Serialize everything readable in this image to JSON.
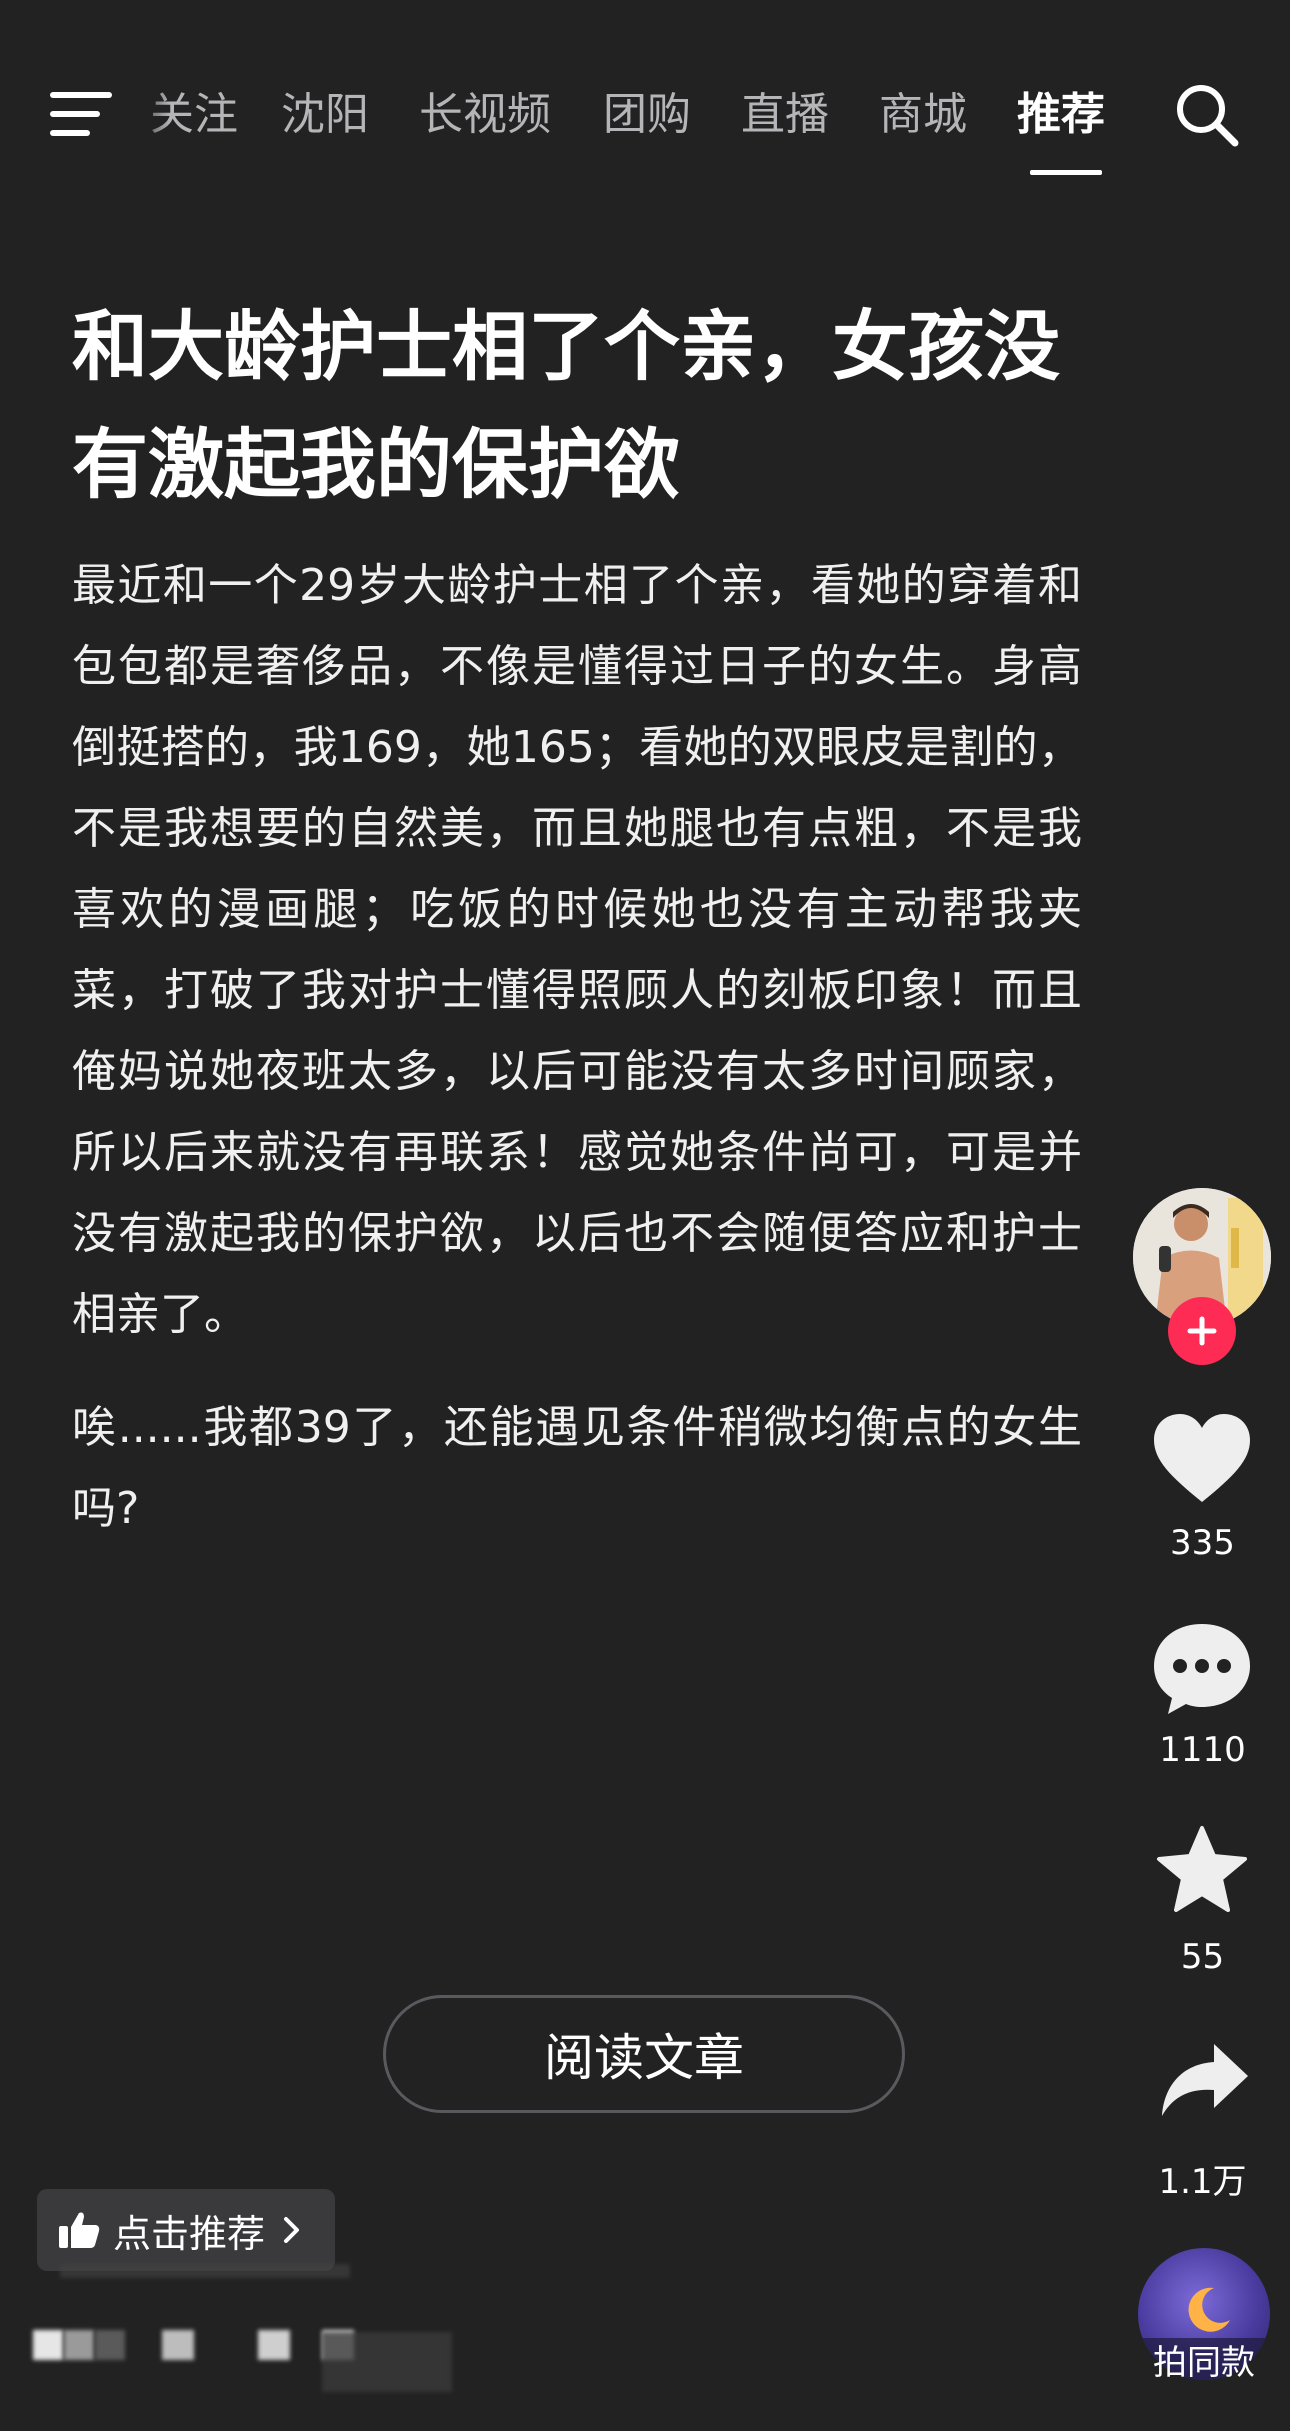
{
  "nav": {
    "tabs": [
      {
        "label": "关注"
      },
      {
        "label": "沈阳"
      },
      {
        "label": "长视频"
      },
      {
        "label": "团购"
      },
      {
        "label": "直播"
      },
      {
        "label": "商城"
      },
      {
        "label": "推荐"
      }
    ],
    "active_tab": "推荐"
  },
  "post": {
    "title": "和大龄护士相了个亲，女孩没有激起我的保护欲",
    "paragraphs": [
      "最近和一个29岁大龄护士相了个亲，看她的穿着和包包都是奢侈品，不像是懂得过日子的女生。身高倒挺搭的，我169，她165；看她的双眼皮是割的，不是我想要的自然美，而且她腿也有点粗，不是我喜欢的漫画腿；吃饭的时候她也没有主动帮我夹菜，打破了我对护士懂得照顾人的刻板印象！而且俺妈说她夜班太多，以后可能没有太多时间顾家，所以后来就没有再联系！感觉她条件尚可，可是并没有激起我的保护欲，以后也不会随便答应和护士相亲了。",
      "唉......我都39了，还能遇见条件稍微均衡点的女生吗?"
    ],
    "read_button": "阅读文章"
  },
  "recommend": {
    "label": "点击推荐",
    "icon": "thumbs-up-icon"
  },
  "actions": {
    "likes": "335",
    "comments": "1110",
    "favorites": "55",
    "shares": "1.1万",
    "music_label": "拍同款"
  },
  "colors": {
    "background": "#222223",
    "follow_button": "#fe2c55",
    "text": "#ffffff",
    "tab_inactive": "#b5b5b8"
  }
}
